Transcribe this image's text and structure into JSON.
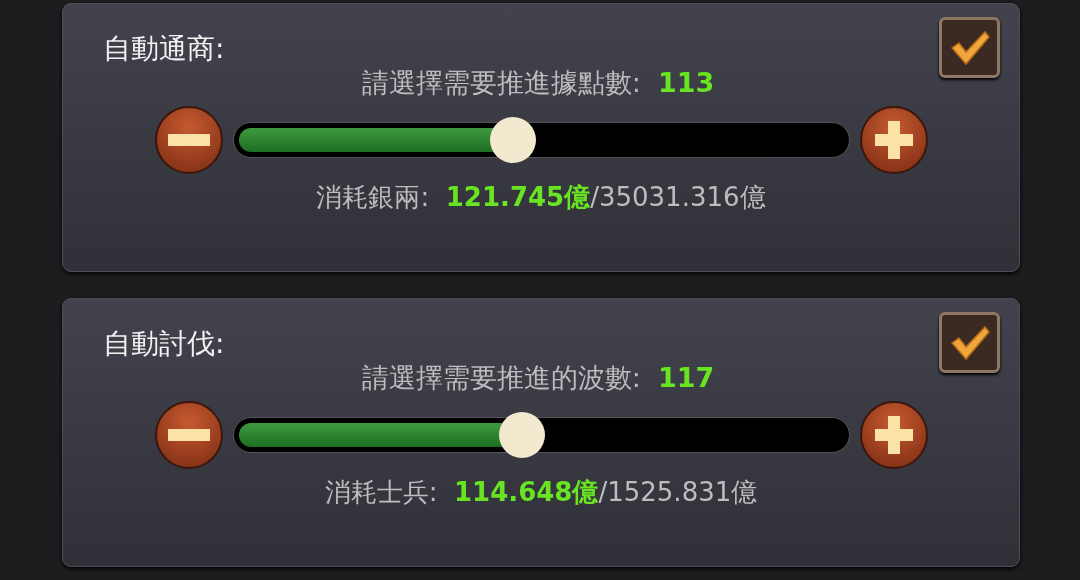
{
  "panels": [
    {
      "title": "自動通商:",
      "checked": true,
      "prompt_label": "請選擇需要推進據點數:",
      "prompt_value": "113",
      "level": 0.455,
      "cost_label": "消耗銀兩:",
      "cost_value": "121.745億",
      "cost_total": "/35031.316億"
    },
    {
      "title": "自動討伐:",
      "checked": true,
      "prompt_label": "請選擇需要推進的波數:",
      "prompt_value": "117",
      "level": 0.47,
      "cost_label": "消耗士兵:",
      "cost_value": "114.648億",
      "cost_total": "/1525.831億"
    }
  ]
}
